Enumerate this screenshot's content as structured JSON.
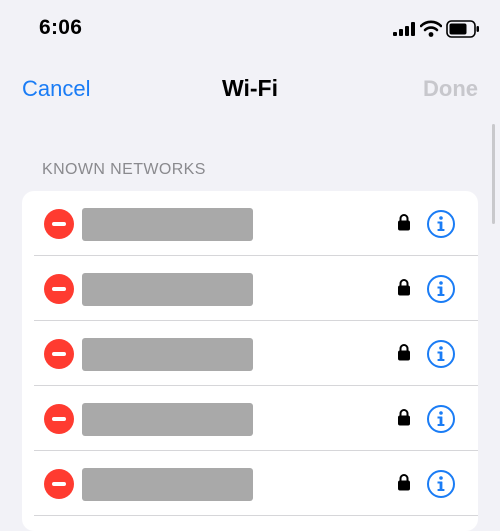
{
  "status_bar": {
    "time": "6:06",
    "icons": [
      "signal-icon",
      "wifi-icon",
      "battery-icon"
    ]
  },
  "nav": {
    "cancel_label": "Cancel",
    "title": "Wi-Fi",
    "done_label": "Done"
  },
  "section": {
    "header": "KNOWN NETWORKS"
  },
  "networks": [
    {
      "name": "",
      "secured": true
    },
    {
      "name": "",
      "secured": true
    },
    {
      "name": "",
      "secured": true
    },
    {
      "name": "",
      "secured": true
    },
    {
      "name": "",
      "secured": true
    }
  ],
  "colors": {
    "accent": "#1a7cf5",
    "delete": "#ff3b30",
    "done_disabled": "#c7c7cc",
    "background": "#f2f2f7"
  }
}
